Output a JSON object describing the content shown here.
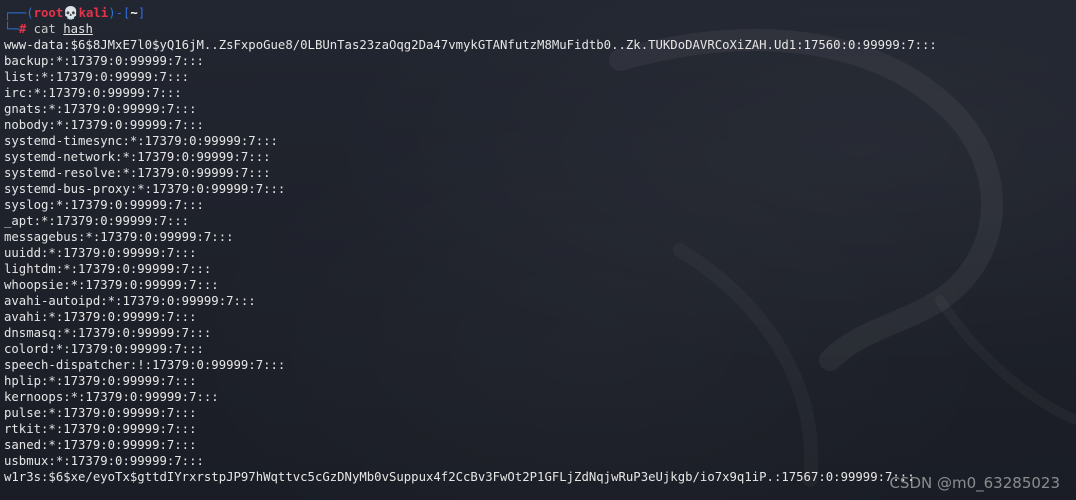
{
  "prompt": {
    "user": "root",
    "host": "kali",
    "dir": "~",
    "command": "cat",
    "argument": "hash"
  },
  "output_lines": [
    "www-data:$6$8JMxE7l0$yQ16jM..ZsFxpoGue8/0LBUnTas23zaOqg2Da47vmykGTANfutzM8MuFidtb0..Zk.TUKDoDAVRCoXiZAH.Ud1:17560:0:99999:7:::",
    "backup:*:17379:0:99999:7:::",
    "list:*:17379:0:99999:7:::",
    "irc:*:17379:0:99999:7:::",
    "gnats:*:17379:0:99999:7:::",
    "nobody:*:17379:0:99999:7:::",
    "systemd-timesync:*:17379:0:99999:7:::",
    "systemd-network:*:17379:0:99999:7:::",
    "systemd-resolve:*:17379:0:99999:7:::",
    "systemd-bus-proxy:*:17379:0:99999:7:::",
    "syslog:*:17379:0:99999:7:::",
    "_apt:*:17379:0:99999:7:::",
    "messagebus:*:17379:0:99999:7:::",
    "uuidd:*:17379:0:99999:7:::",
    "lightdm:*:17379:0:99999:7:::",
    "whoopsie:*:17379:0:99999:7:::",
    "avahi-autoipd:*:17379:0:99999:7:::",
    "avahi:*:17379:0:99999:7:::",
    "dnsmasq:*:17379:0:99999:7:::",
    "colord:*:17379:0:99999:7:::",
    "speech-dispatcher:!:17379:0:99999:7:::",
    "hplip:*:17379:0:99999:7:::",
    "kernoops:*:17379:0:99999:7:::",
    "pulse:*:17379:0:99999:7:::",
    "rtkit:*:17379:0:99999:7:::",
    "saned:*:17379:0:99999:7:::",
    "usbmux:*:17379:0:99999:7:::",
    "w1r3s:$6$xe/eyoTx$gttdIYrxrstpJP97hWqttvc5cGzDNyMb0vSuppux4f2CcBv3FwOt2P1GFLjZdNqjwRuP3eUjkgb/io7x9q1iP.:17567:0:99999:7:::"
  ],
  "watermark": "CSDN @m0_63285023",
  "colors": {
    "background": "#1d2028",
    "prompt_frame": "#2f6fd6",
    "prompt_user": "#e3344a",
    "text": "#e6e6e6"
  }
}
